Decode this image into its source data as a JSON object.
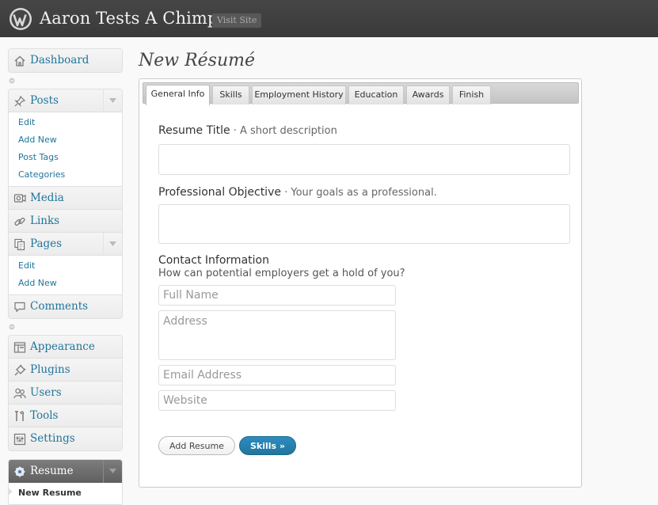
{
  "header": {
    "site_title": "Aaron Tests A Chimp",
    "visit_site": "Visit Site"
  },
  "sidebar": {
    "dashboard": "Dashboard",
    "posts": "Posts",
    "posts_sub": [
      "Edit",
      "Add New",
      "Post Tags",
      "Categories"
    ],
    "media": "Media",
    "links": "Links",
    "pages": "Pages",
    "pages_sub": [
      "Edit",
      "Add New"
    ],
    "comments": "Comments",
    "appearance": "Appearance",
    "plugins": "Plugins",
    "users": "Users",
    "tools": "Tools",
    "settings": "Settings",
    "resume": "Resume",
    "resume_sub": [
      "New Resume"
    ]
  },
  "main": {
    "page_title": "New Résumé",
    "tabs": [
      "General Info",
      "Skills",
      "Employment History",
      "Education",
      "Awards",
      "Finish"
    ],
    "active_tab": "General Info",
    "resume_title_label": "Resume Title",
    "resume_title_hint": " · A short description",
    "resume_title_value": "",
    "objective_label": "Professional Objective",
    "objective_hint": " · Your goals as a professional.",
    "objective_value": "",
    "contact_label": "Contact Information",
    "contact_desc": "How can potential employers get a hold of you?",
    "full_name_placeholder": "Full Name",
    "address_placeholder": "Address",
    "email_placeholder": "Email Address",
    "website_placeholder": "Website",
    "add_button": "Add Resume",
    "next_button": "Skills »"
  },
  "colors": {
    "link": "#21759b",
    "header_bg": "#464646",
    "primary_button": "#21759b"
  }
}
